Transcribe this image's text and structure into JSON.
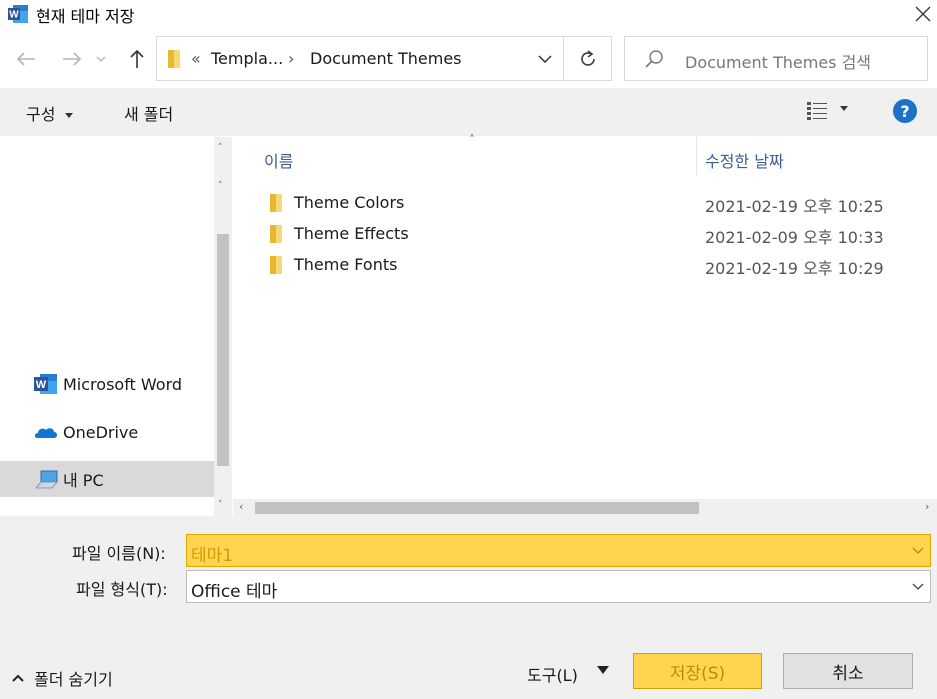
{
  "window": {
    "title": "현재 테마 저장"
  },
  "nav": {
    "breadcrumb_prefix": "«",
    "breadcrumb_parent": "Templa...",
    "breadcrumb_sep": "›",
    "breadcrumb_current": "Document Themes",
    "search_placeholder": "Document Themes 검색"
  },
  "toolbar": {
    "organize_label": "구성",
    "new_folder_label": "새 폴더",
    "help_label": "?"
  },
  "sidebar": {
    "items": [
      {
        "label": "Microsoft Word",
        "icon": "word-icon"
      },
      {
        "label": "OneDrive",
        "icon": "onedrive-icon"
      },
      {
        "label": "내 PC",
        "icon": "pc-icon",
        "selected": true
      }
    ]
  },
  "filelist": {
    "columns": [
      "이름",
      "수정한 날짜"
    ],
    "rows": [
      {
        "name": "Theme Colors",
        "date": "2021-02-19 오후 10:25"
      },
      {
        "name": "Theme Effects",
        "date": "2021-02-09 오후 10:33"
      },
      {
        "name": "Theme Fonts",
        "date": "2021-02-19 오후 10:29"
      }
    ]
  },
  "form": {
    "filename_label": "파일 이름(N):",
    "filename_value": "테마1",
    "filetype_label": "파일 형식(T):",
    "filetype_value": "Office 테마"
  },
  "footer": {
    "hide_folders_label": "폴더 숨기기",
    "tools_label": "도구(L)",
    "save_label": "저장(S)",
    "cancel_label": "취소"
  },
  "colors": {
    "accent_highlight": "#ffd54f",
    "help_blue": "#1a73c8",
    "word_blue": "#2b579a"
  }
}
